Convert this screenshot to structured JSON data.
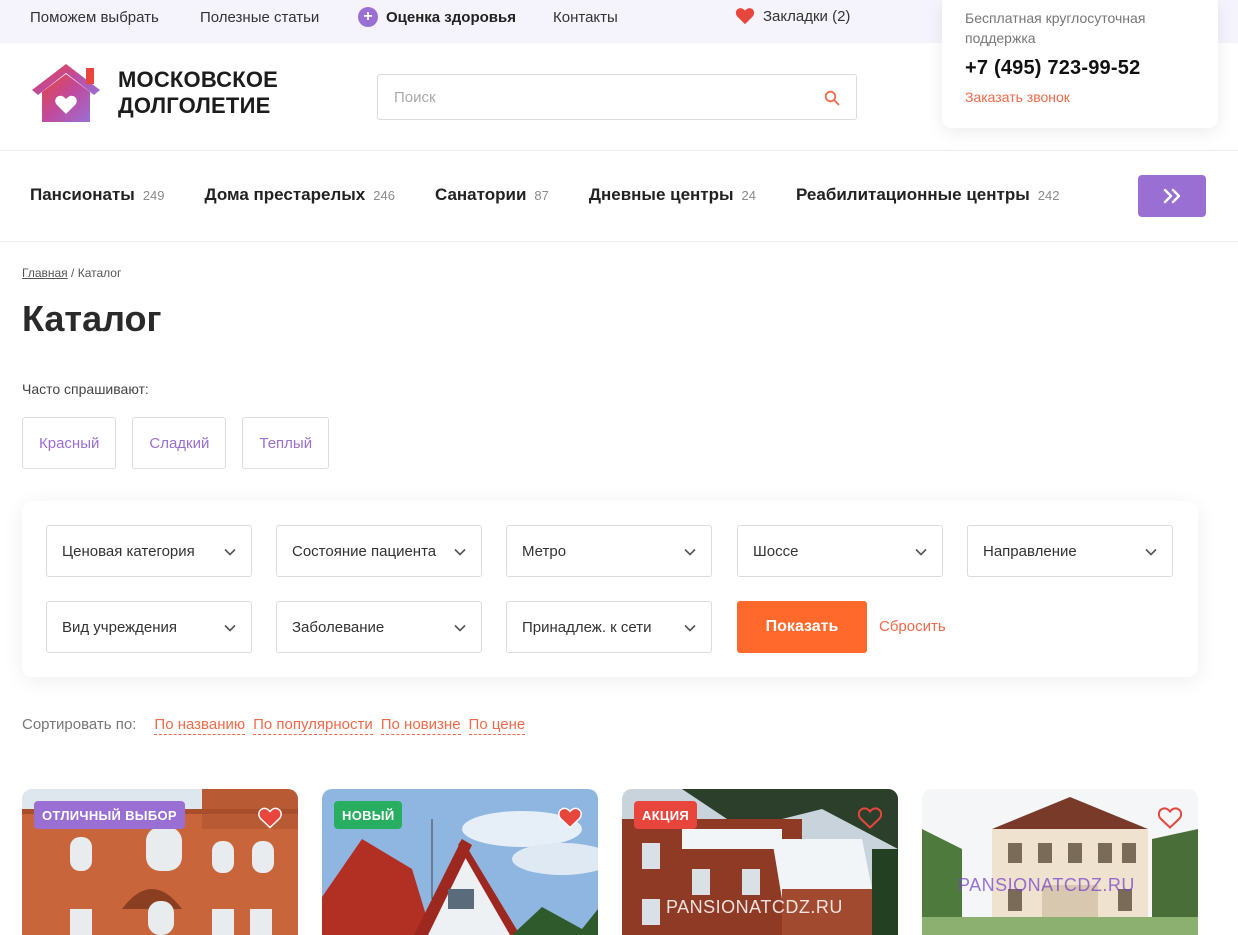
{
  "topbar": {
    "help_choose": "Поможем выбрать",
    "articles": "Полезные статьи",
    "health": "Оценка здоровья",
    "contacts": "Контакты",
    "bookmarks": "Закладки (2)"
  },
  "support": {
    "caption": "Бесплатная круглосуточная поддержка",
    "phone": "+7 (495) 723-99-52",
    "callback": "Заказать звонок"
  },
  "logo": {
    "line1": "МОСКОВСКОЕ",
    "line2": "ДОЛГОЛЕТИЕ"
  },
  "search": {
    "placeholder": "Поиск"
  },
  "categories": [
    {
      "name": "Пансионаты",
      "count": "249"
    },
    {
      "name": "Дома престарелых",
      "count": "246"
    },
    {
      "name": "Санатории",
      "count": "87"
    },
    {
      "name": "Дневные центры",
      "count": "24"
    },
    {
      "name": "Реабилитационные центры",
      "count": "242"
    }
  ],
  "breadcrumb": {
    "home": "Главная",
    "separator": " / ",
    "current": "Каталог"
  },
  "page_title": "Каталог",
  "faq": {
    "label": "Часто спрашивают:",
    "chips": [
      "Красный",
      "Сладкий",
      "Теплый"
    ]
  },
  "filters": {
    "selects": [
      "Ценовая категория",
      "Состояние пациента",
      "Метро",
      "Шоссе",
      "Направление",
      "Вид учреждения",
      "Заболевание",
      "Принадлеж. к сети"
    ],
    "show": "Показать",
    "reset": "Сбросить"
  },
  "sort": {
    "label": "Сортировать по:",
    "options": [
      "По названию",
      "По популярности",
      "По новизне",
      "По цене"
    ]
  },
  "cards": [
    {
      "badge": "ОТЛИЧНЫЙ ВЫБОР",
      "badge_color": "#9a6fd4",
      "watermark": ""
    },
    {
      "badge": "НОВЫЙ",
      "badge_color": "#27ae60",
      "watermark": ""
    },
    {
      "badge": "АКЦИЯ",
      "badge_color": "#e8453c",
      "watermark": "PANSIONATCDZ.RU"
    },
    {
      "badge": "",
      "badge_color": "",
      "watermark": "PANSIONATCDZ.RU"
    }
  ],
  "colors": {
    "accent": "#9a6fd4",
    "orange": "#ff6a2c",
    "link": "#f06a4a",
    "heart": "#e8453c"
  }
}
